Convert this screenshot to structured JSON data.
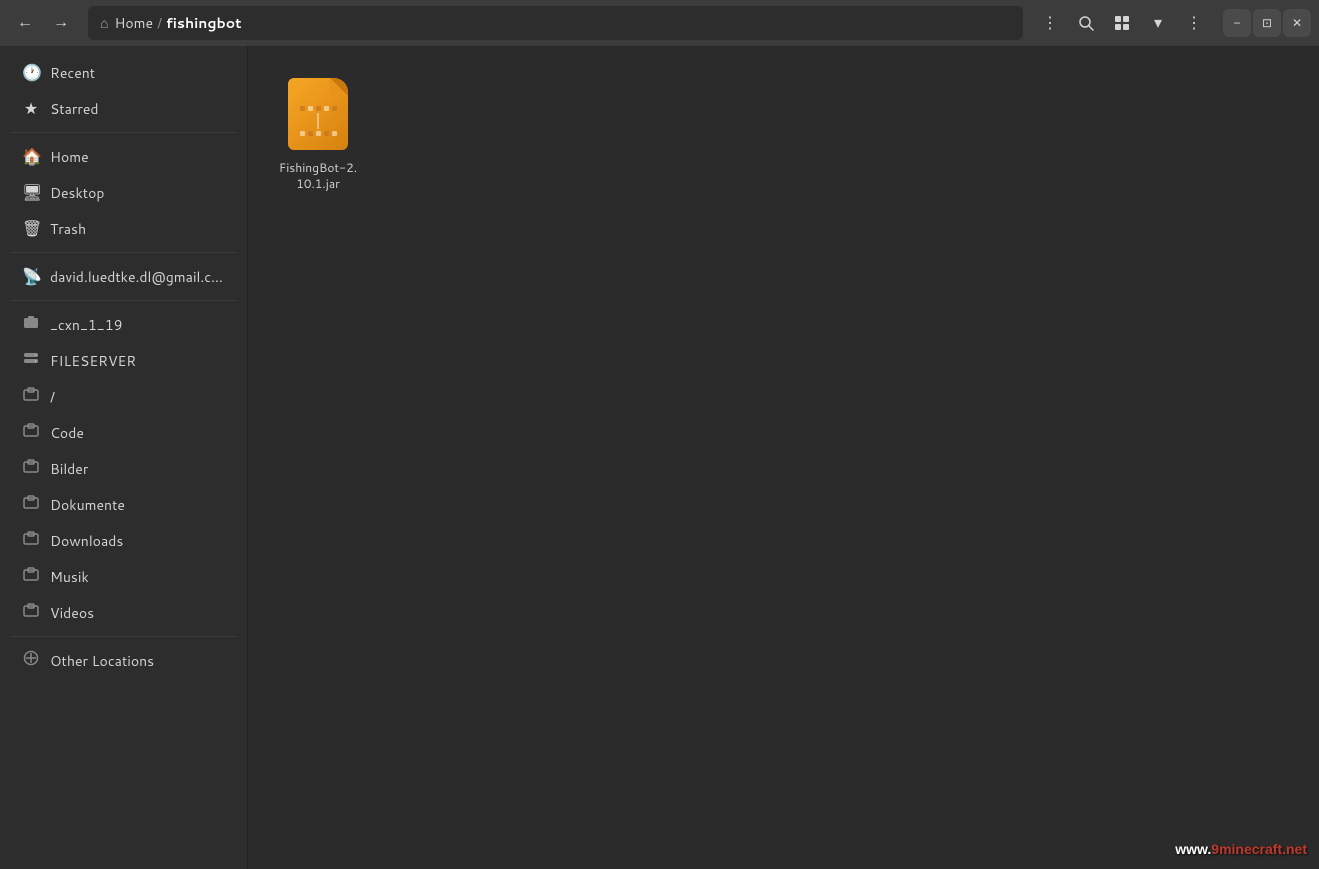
{
  "window": {
    "title": "fishingbot"
  },
  "titlebar": {
    "back_label": "←",
    "forward_label": "→",
    "home_icon": "⌂",
    "breadcrumb": {
      "home": "Home",
      "separator": "/",
      "current": "fishingbot"
    },
    "menu_icon": "⋮",
    "search_icon": "🔍",
    "view_icon": "⊞",
    "view_arrow": "▾",
    "options_icon": "⋮",
    "minimize_label": "−",
    "maximize_label": "⊡",
    "close_label": "✕"
  },
  "sidebar": {
    "items": [
      {
        "id": "recent",
        "icon": "🕐",
        "label": "Recent"
      },
      {
        "id": "starred",
        "icon": "★",
        "label": "Starred"
      },
      {
        "id": "home",
        "icon": "⌂",
        "label": "Home"
      },
      {
        "id": "desktop",
        "icon": "🖥",
        "label": "Desktop"
      },
      {
        "id": "trash",
        "icon": "🗑",
        "label": "Trash"
      },
      {
        "id": "email",
        "icon": "📡",
        "label": "david.luedtke.dl@gmail.com"
      },
      {
        "id": "cxn",
        "icon": "📁",
        "label": "_cxn_1_19"
      },
      {
        "id": "fileserver",
        "icon": "💾",
        "label": "FILESERVER"
      },
      {
        "id": "root",
        "icon": "📁",
        "label": "/"
      },
      {
        "id": "code",
        "icon": "📁",
        "label": "Code"
      },
      {
        "id": "bilder",
        "icon": "📁",
        "label": "Bilder"
      },
      {
        "id": "dokumente",
        "icon": "📁",
        "label": "Dokumente"
      },
      {
        "id": "downloads",
        "icon": "📁",
        "label": "Downloads"
      },
      {
        "id": "musik",
        "icon": "📁",
        "label": "Musik"
      },
      {
        "id": "videos",
        "icon": "📁",
        "label": "Videos"
      },
      {
        "id": "other-locations",
        "icon": "+",
        "label": "Other Locations"
      }
    ]
  },
  "files": [
    {
      "name": "FishingBot-2.10.1.jar",
      "type": "jar"
    }
  ],
  "watermark": "www.9minecraft.net"
}
